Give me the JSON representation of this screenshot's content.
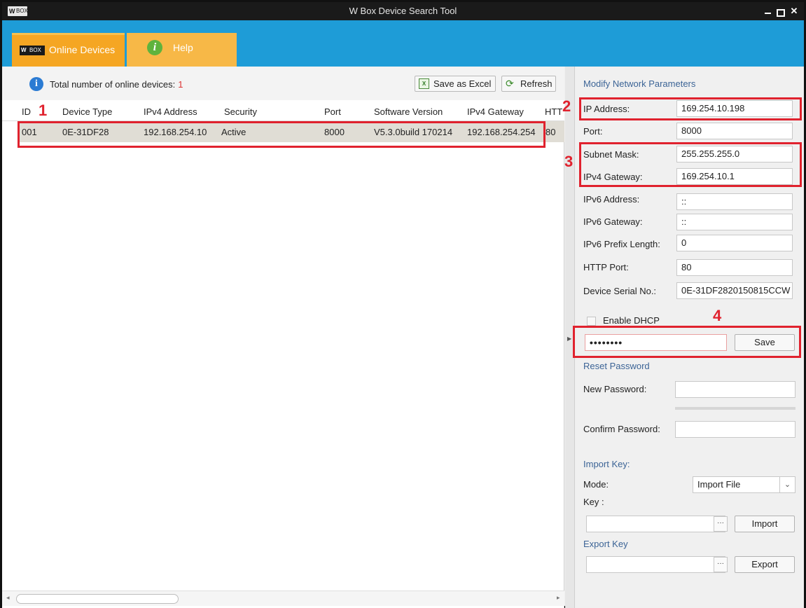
{
  "window": {
    "title": "W Box Device Search Tool",
    "logo_w": "W",
    "logo_box": "BOX"
  },
  "tabs": {
    "online_label": "Online Devices",
    "help_label": "Help",
    "help_icon_glyph": "i",
    "logo_w": "W",
    "logo_box": "BOX"
  },
  "toolbar": {
    "total_label": "Total number of online devices:",
    "total_count": "1",
    "save_excel_label": "Save as Excel",
    "refresh_label": "Refresh"
  },
  "table": {
    "columns": [
      "ID",
      "Device Type",
      "IPv4 Address",
      "Security",
      "Port",
      "Software Version",
      "IPv4 Gateway",
      "HTT"
    ],
    "rows": [
      [
        "001",
        "0E-31DF28",
        "192.168.254.10",
        "Active",
        "8000",
        "V5.3.0build 170214",
        "192.168.254.254",
        "80"
      ]
    ]
  },
  "params": {
    "section_title": "Modify Network Parameters",
    "ip_label": "IP Address:",
    "ip_value": "169.254.10.198",
    "port_label": "Port:",
    "port_value": "8000",
    "subnet_label": "Subnet Mask:",
    "subnet_value": "255.255.255.0",
    "gateway_label": "IPv4 Gateway:",
    "gateway_value": "169.254.10.1",
    "ipv6_label": "IPv6 Address:",
    "ipv6_value": "::",
    "ipv6_gw_label": "IPv6 Gateway:",
    "ipv6_gw_value": "::",
    "ipv6_prefix_label": "IPv6 Prefix Length:",
    "ipv6_prefix_value": "0",
    "http_label": "HTTP Port:",
    "http_value": "80",
    "serial_label": "Device Serial No.:",
    "serial_value": "0E-31DF2820150815CCW",
    "dhcp_label": "Enable DHCP",
    "password_value": "••••••••",
    "save_label": "Save"
  },
  "reset": {
    "section_title": "Reset Password",
    "new_label": "New Password:",
    "confirm_label": "Confirm Password:"
  },
  "import_key": {
    "section_title": "Import Key:",
    "mode_label": "Mode:",
    "mode_value": "Import File",
    "key_label": "Key :",
    "browse_label": "···",
    "import_label": "Import"
  },
  "export_key": {
    "section_title": "Export Key",
    "browse_label": "···",
    "export_label": "Export"
  },
  "annotations": {
    "n1": "1",
    "n2": "2",
    "n3": "3",
    "n4": "4",
    "color": "#e0222e"
  },
  "icons": {
    "info": "info-icon",
    "excel": "excel-icon",
    "refresh": "refresh-icon"
  }
}
